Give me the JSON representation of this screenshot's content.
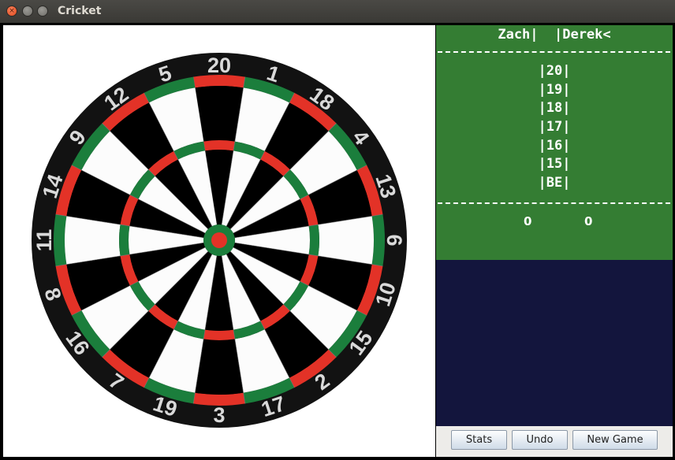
{
  "window": {
    "title": "Cricket"
  },
  "board": {
    "numbers": [
      "20",
      "1",
      "18",
      "4",
      "13",
      "6",
      "10",
      "15",
      "2",
      "17",
      "3",
      "19",
      "7",
      "16",
      "8",
      "11",
      "14",
      "9",
      "12",
      "5"
    ],
    "colors": {
      "black": "#000000",
      "white": "#fcfcfc",
      "red": "#e33227",
      "green": "#1b7e3c",
      "number_ring": "#121212",
      "numbers": "#d9d9d9"
    }
  },
  "scoreboard": {
    "players_line": "Zach|  |Derek<",
    "rows": [
      "|20|",
      "|19|",
      "|18|",
      "|17|",
      "|16|",
      "|15|",
      "|BE|"
    ],
    "scores": [
      "0",
      "0"
    ],
    "colors": {
      "scoreboard_bg": "#347d33",
      "stats_bg": "#13153d"
    }
  },
  "buttons": {
    "stats": "Stats",
    "undo": "Undo",
    "new_game": "New Game"
  }
}
